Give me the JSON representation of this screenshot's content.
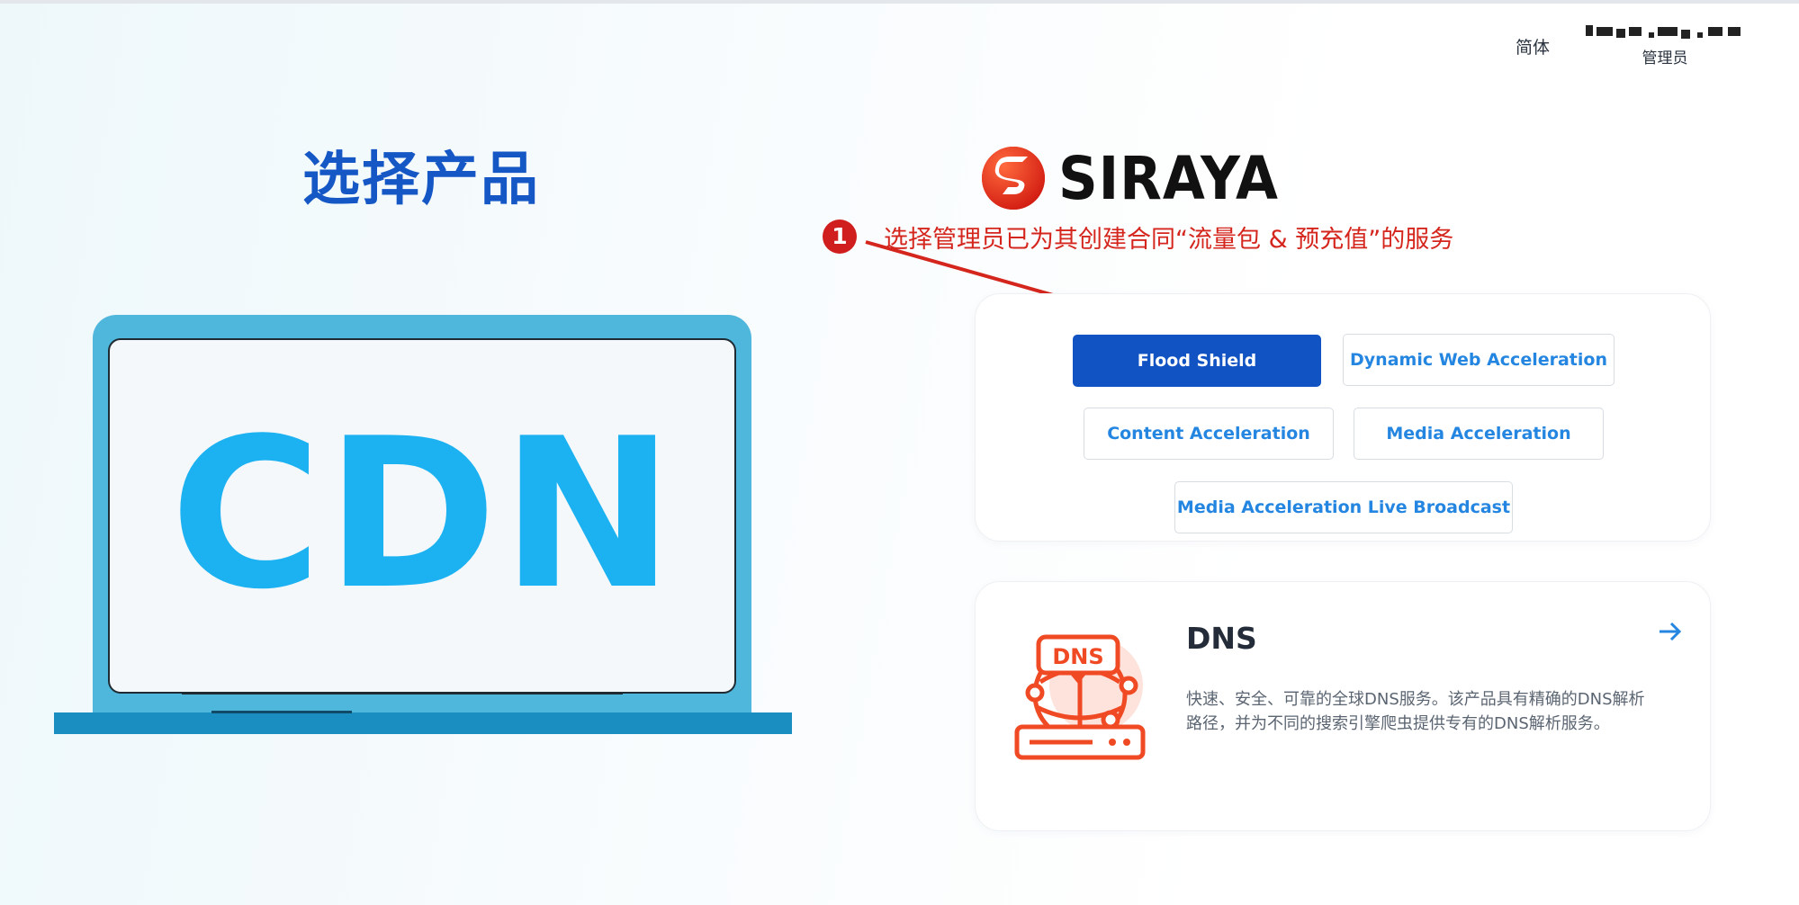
{
  "header": {
    "language": "简体",
    "user_role": "管理员"
  },
  "page_title": "选择产品",
  "cdn_hero": {
    "text": "CDN"
  },
  "brand": {
    "name": "SIRAYA"
  },
  "annotation": {
    "step": "1",
    "text": "选择管理员已为其创建合同“流量包 & 预充值”的服务"
  },
  "products": {
    "items": [
      {
        "label": "Flood Shield",
        "active": true
      },
      {
        "label": "Dynamic Web Acceleration",
        "active": false
      },
      {
        "label": "Content Acceleration",
        "active": false
      },
      {
        "label": "Media Acceleration",
        "active": false
      },
      {
        "label": "Media Acceleration Live Broadcast",
        "active": false
      }
    ]
  },
  "dns": {
    "title": "DNS",
    "description": "快速、安全、可靠的全球DNS服务。该产品具有精确的DNS解析路径，并为不同的搜索引擎爬虫提供专有的DNS解析服务。",
    "icon_text": "DNS"
  },
  "colors": {
    "accent": "#1153c3",
    "link": "#2486e0",
    "title": "#1557c5",
    "cdn": "#1cb2f2",
    "annotation": "#d5261e",
    "dns_icon": "#f04a24"
  }
}
